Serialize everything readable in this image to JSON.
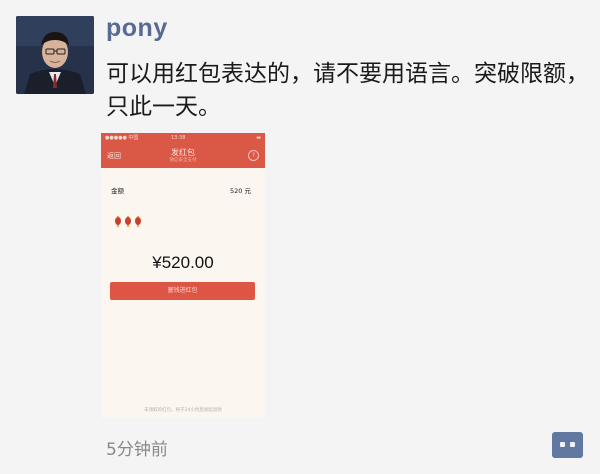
{
  "post": {
    "username": "pony",
    "message": "可以用红包表达的，请不要用语言。突破限额，只此一天。",
    "timestamp": "5分钟前"
  },
  "phone_screenshot": {
    "status_left": "●●●●● 中国",
    "status_time": "13:38",
    "status_right": "▬",
    "back_label": "返回",
    "title": "发红包",
    "subtitle": "微信安全支付",
    "help_icon": "?",
    "amount_label": "金额",
    "amount_value": "520 元",
    "amount_display": "¥520.00",
    "button_label": "塞钱进红包",
    "footer_text": "未领取的红包，将于24小时后发起退款"
  },
  "icons": {
    "avatar": "avatar-photo",
    "comment": "comment-icon"
  },
  "colors": {
    "name_blue": "#576b95",
    "red": "#d95946",
    "comment_button": "#6178a1"
  }
}
